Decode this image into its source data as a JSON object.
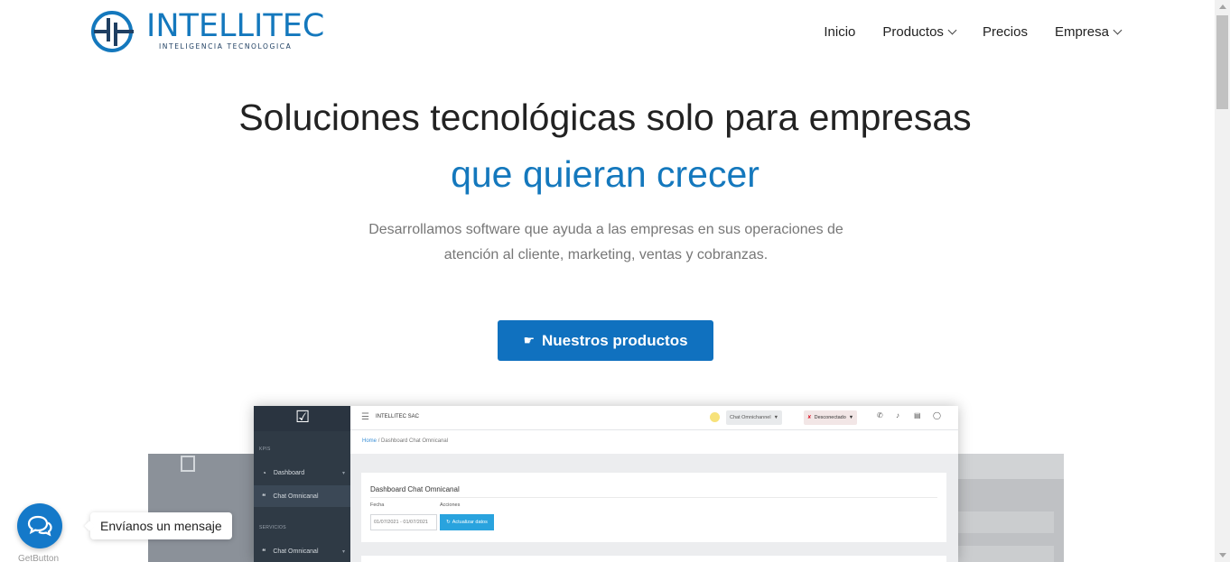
{
  "brand": {
    "name": "INTELLITEC",
    "tagline": "INTELIGENCIA TECNOLOGICA",
    "color": "#1478bd"
  },
  "nav": {
    "items": [
      {
        "label": "Inicio"
      },
      {
        "label": "Productos",
        "dropdown": true
      },
      {
        "label": "Precios"
      },
      {
        "label": "Empresa",
        "dropdown": true
      }
    ]
  },
  "hero": {
    "title": "Soluciones tecnológicas solo para empresas",
    "title_accent": "que quieran crecer",
    "description_line1": "Desarrollamos software que ayuda a las empresas en sus operaciones de",
    "description_line2": "atención al cliente, marketing, ventas y cobranzas.",
    "cta_label": "Nuestros productos",
    "cta_icon": "pointing-hand-icon",
    "cta_color": "#1071bf"
  },
  "mockup": {
    "company": "INTELLITEC SAC",
    "sidebar": {
      "section_kpis": "KPIS",
      "section_services": "SERVICIOS",
      "items": [
        {
          "label": "Dashboard"
        },
        {
          "label": "Chat Omnicanal"
        },
        {
          "label": "Chat Omnicanal"
        }
      ]
    },
    "topbar": {
      "channel": "Chat Omnichannel",
      "status": "Desconectado"
    },
    "breadcrumb": {
      "home": "Home",
      "separator": "/",
      "current": "Dashboard Chat Omnicanal"
    },
    "card": {
      "title": "Dashboard Chat Omnicanal",
      "date_label": "Fecha",
      "actions_label": "Acciones",
      "date_value": "01/07/2021 - 01/07/2021",
      "refresh_label": "Actualizar datos"
    }
  },
  "chat_widget": {
    "message": "Envíanos un mensaje",
    "provider": "GetButton",
    "color": "#1479c9"
  }
}
